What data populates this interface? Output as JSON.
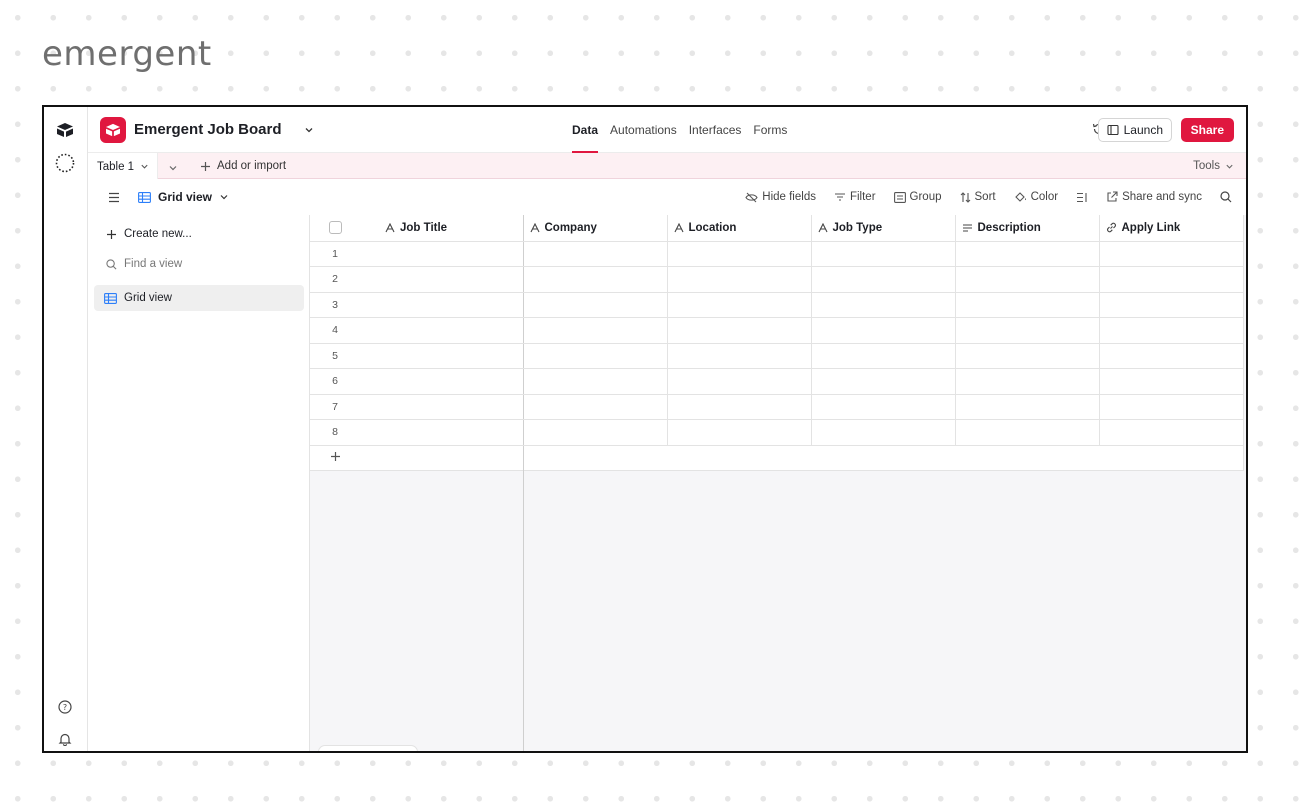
{
  "brand": {
    "logo_text": "emergent"
  },
  "header": {
    "base_name": "Emergent Job Board",
    "tabs": [
      {
        "label": "Data",
        "active": true
      },
      {
        "label": "Automations",
        "active": false
      },
      {
        "label": "Interfaces",
        "active": false
      },
      {
        "label": "Forms",
        "active": false
      }
    ],
    "launch_label": "Launch",
    "share_label": "Share"
  },
  "tablebar": {
    "table_tab": "Table 1",
    "add_import": "Add or import",
    "tools": "Tools"
  },
  "viewbar": {
    "view_name": "Grid view",
    "tools": [
      "Hide fields",
      "Filter",
      "Group",
      "Sort",
      "Color",
      "Share and sync"
    ]
  },
  "sidebar": {
    "create_label": "Create new...",
    "find_placeholder": "Find a view",
    "views": [
      "Grid view"
    ]
  },
  "grid": {
    "columns": [
      {
        "label": "Job Title",
        "icon": "text-icon"
      },
      {
        "label": "Company",
        "icon": "text-icon"
      },
      {
        "label": "Location",
        "icon": "text-icon"
      },
      {
        "label": "Job Type",
        "icon": "text-icon"
      },
      {
        "label": "Description",
        "icon": "long-text-icon"
      },
      {
        "label": "Apply Link",
        "icon": "link-icon"
      }
    ],
    "row_numbers": [
      "1",
      "2",
      "3",
      "4",
      "5",
      "6",
      "7",
      "8"
    ]
  },
  "colors": {
    "accent": "#e0173f",
    "tablebar_bg": "#fdf0f3"
  }
}
